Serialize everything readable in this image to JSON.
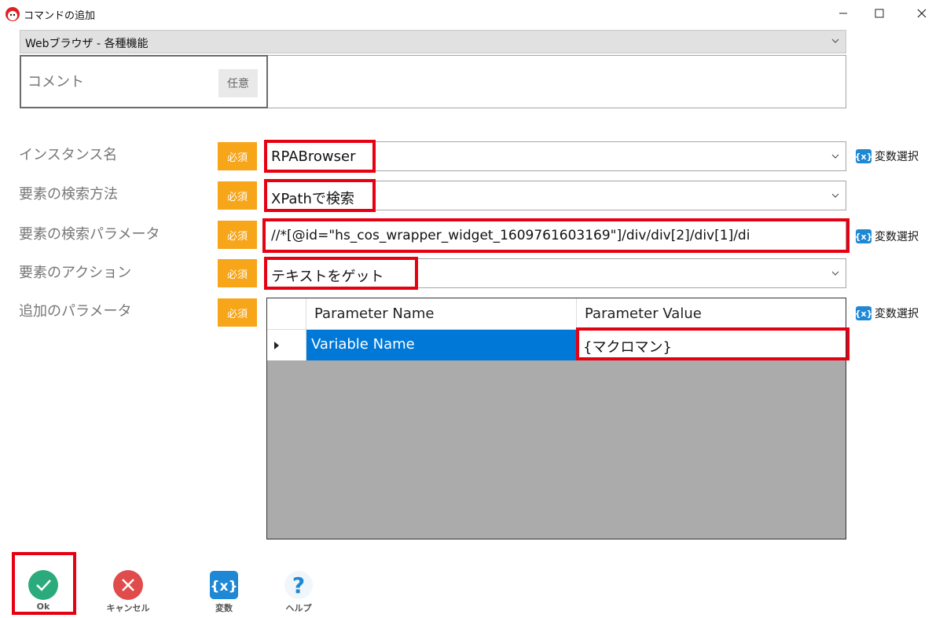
{
  "window": {
    "title": "コマンドの追加"
  },
  "category": {
    "selected": "Webブラウザ - 各種機能"
  },
  "comment": {
    "label": "コメント",
    "badge": "任意",
    "value": ""
  },
  "fields": {
    "required_badge": "必須",
    "instance": {
      "label": "インスタンス名",
      "value": "RPABrowser"
    },
    "search_method": {
      "label": "要素の検索方法",
      "value": "XPathで検索"
    },
    "search_param": {
      "label": "要素の検索パラメータ",
      "value": "//*[@id=\"hs_cos_wrapper_widget_1609761603169\"]/div/div[2]/div[1]/di"
    },
    "action": {
      "label": "要素のアクション",
      "value": "テキストをゲット"
    },
    "extra_params": {
      "label": "追加のパラメータ"
    }
  },
  "var_select_label": "変数選択",
  "var_icon_text": "{x}",
  "grid": {
    "columns": [
      "Parameter Name",
      "Parameter Value"
    ],
    "rows": [
      {
        "name": "Variable Name",
        "value": "{マクロマン}"
      }
    ]
  },
  "toolbar": {
    "ok": "Ok",
    "cancel": "キャンセル",
    "variables": "変数",
    "help": "ヘルプ"
  },
  "colors": {
    "required": "#f7a61a",
    "highlight": "#e60012",
    "selected_cell": "#0078d7",
    "ok_green": "#2bab7c",
    "cancel_red": "#e04b4b",
    "var_blue": "#1e88d4"
  }
}
